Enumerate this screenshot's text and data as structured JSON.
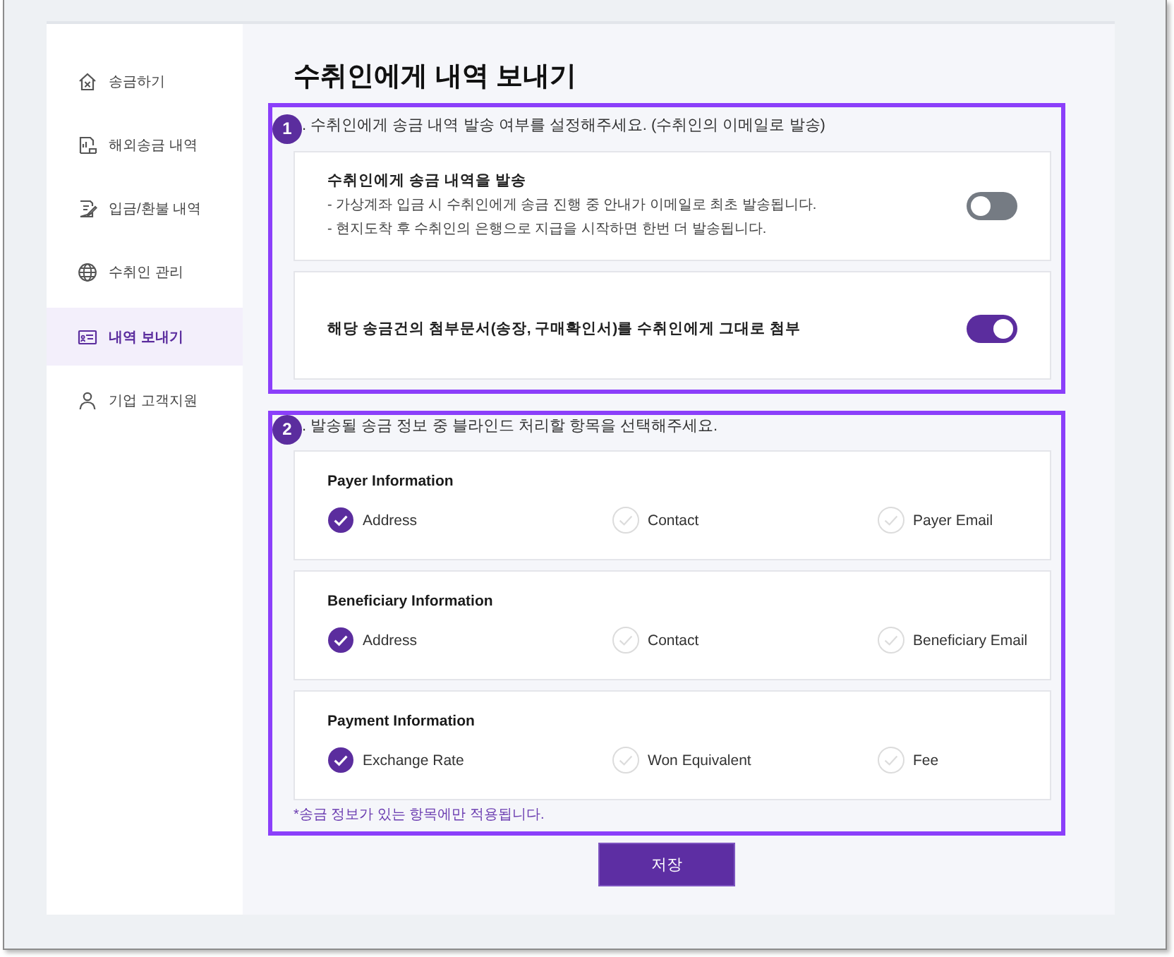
{
  "sidebar": {
    "items": [
      {
        "label": "송금하기",
        "selected": false
      },
      {
        "label": "해외송금 내역",
        "selected": false
      },
      {
        "label": "입금/환불 내역",
        "selected": false
      },
      {
        "label": "수취인 관리",
        "selected": false
      },
      {
        "label": "내역 보내기",
        "selected": true
      },
      {
        "label": "기업 고객지원",
        "selected": false
      }
    ]
  },
  "page": {
    "title": "수취인에게 내역 보내기"
  },
  "sections": [
    {
      "kind": "toggles",
      "callout": "1",
      "heading": ". 수취인에게 송금 내역 발송 여부를 설정해주세요. (수취인의 이메일로 발송)",
      "settings": [
        {
          "title": "수취인에게 송금 내역을 발송",
          "lines": [
            "- 가상계좌 입금 시 수취인에게 송금 진행 중 안내가 이메일로 최초 발송됩니다.",
            "- 현지도착 후 수취인의 은행으로 지급을 시작하면 한번 더 발송됩니다."
          ],
          "on": false
        },
        {
          "title": "해당 송금건의 첨부문서(송장, 구매확인서)를 수취인에게 그대로 첨부",
          "on": true
        }
      ]
    },
    {
      "kind": "checklists",
      "callout": "2",
      "heading": ". 발송될 송금 정보 중 블라인드 처리할 항목을 선택해주세요.",
      "groups": [
        {
          "title": "Payer Information",
          "options": [
            {
              "label": "Address",
              "checked": true
            },
            {
              "label": "Contact",
              "checked": false
            },
            {
              "label": "Payer Email",
              "checked": false
            }
          ]
        },
        {
          "title": "Beneficiary Information",
          "options": [
            {
              "label": "Address",
              "checked": true
            },
            {
              "label": "Contact",
              "checked": false
            },
            {
              "label": "Beneficiary Email",
              "checked": false
            }
          ]
        },
        {
          "title": "Payment Information",
          "options": [
            {
              "label": "Exchange Rate",
              "checked": true
            },
            {
              "label": "Won Equivalent",
              "checked": false
            },
            {
              "label": "Fee",
              "checked": false
            }
          ]
        }
      ],
      "note": "*송금 정보가 있는 항목에만 적용됩니다."
    }
  ],
  "save_button": {
    "label": "저장"
  }
}
